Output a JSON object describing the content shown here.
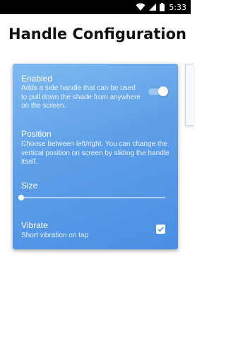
{
  "status_bar": {
    "time": "5:33",
    "icons": [
      "wifi-icon",
      "cellular-signal-icon",
      "battery-icon"
    ]
  },
  "page": {
    "title": "Handle Configuration"
  },
  "settings": {
    "enabled": {
      "title": "Enabled",
      "description": "Adds a side handle that can be used to pull down the shade from anywhere on the screen.",
      "value": true
    },
    "position": {
      "title": "Position",
      "description": "Choose between left/right. You can change the vertical position on screen by sliding the handle itself."
    },
    "size": {
      "title": "Size",
      "level": 0
    },
    "vibrate": {
      "title": "Vibrate",
      "description": "Short vibration on tap",
      "checked": true
    }
  },
  "colors": {
    "card_gradient_start": "#7fbaf0",
    "card_gradient_end": "#4a8fe2",
    "status_bar": "#000000",
    "check_mark": "#5d9fe8"
  }
}
